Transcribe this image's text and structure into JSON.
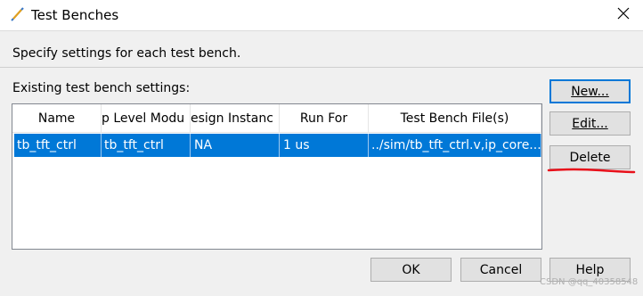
{
  "window": {
    "title": "Test Benches",
    "close_icon": "close-icon",
    "title_icon": "pencil-wand-icon"
  },
  "instructions": "Specify settings for each test bench.",
  "section_label": "Existing test bench settings:",
  "table": {
    "columns": [
      "Name",
      "p Level Modu",
      "esign Instanc",
      "Run For",
      "Test Bench File(s)"
    ],
    "rows": [
      [
        "tb_tft_ctrl",
        "tb_tft_ctrl",
        "NA",
        "1 us",
        "../sim/tb_tft_ctrl.v,ip_core..."
      ]
    ],
    "selected_row": 0
  },
  "buttons": {
    "new": "New...",
    "edit": "Edit...",
    "delete": "Delete",
    "ok": "OK",
    "cancel": "Cancel",
    "help": "Help"
  },
  "watermark": "CSDN @qq_40358548",
  "colors": {
    "selection": "#0078d7",
    "annotation": "#e8101a"
  }
}
